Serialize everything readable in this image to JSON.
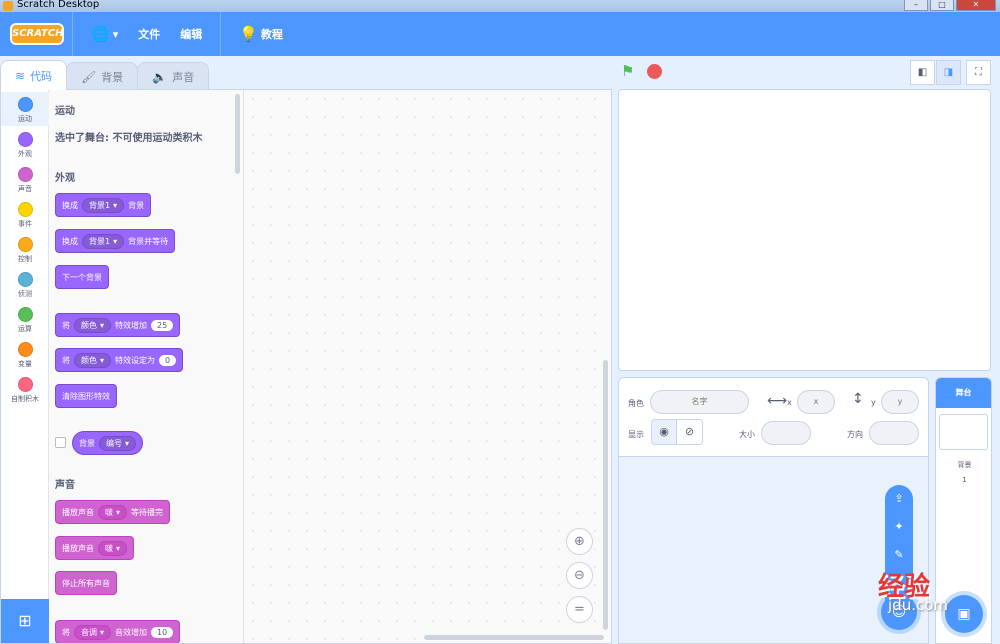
{
  "window": {
    "title": "Scratch Desktop",
    "controls": [
      "–",
      "□",
      "✕"
    ]
  },
  "menubar": {
    "logo": "SCRATCH",
    "language_icon": "globe-icon",
    "items": [
      {
        "label": "文件"
      },
      {
        "label": "编辑"
      }
    ],
    "tutorials_label": "教程"
  },
  "tabs": [
    {
      "label": "代码",
      "icon": "code-icon"
    },
    {
      "label": "背景",
      "icon": "brush-icon"
    },
    {
      "label": "声音",
      "icon": "speaker-icon"
    }
  ],
  "categories": [
    {
      "label": "运动",
      "color": "#4c97ff"
    },
    {
      "label": "外观",
      "color": "#9966ff"
    },
    {
      "label": "声音",
      "color": "#cf63cf"
    },
    {
      "label": "事件",
      "color": "#ffd500"
    },
    {
      "label": "控制",
      "color": "#ffab19"
    },
    {
      "label": "侦测",
      "color": "#5cb1d6"
    },
    {
      "label": "运算",
      "color": "#59c059"
    },
    {
      "label": "变量",
      "color": "#ff8c1a"
    },
    {
      "label": "自制积木",
      "color": "#ff6680"
    }
  ],
  "flyout": {
    "motion_heading": "运动",
    "motion_note": "选中了舞台: 不可使用运动类积木",
    "looks_heading": "外观",
    "looks_blocks": {
      "switch_backdrop": {
        "pre": "换成",
        "menu": "背景1",
        "post": "背景"
      },
      "switch_backdrop_wait": {
        "pre": "换成",
        "menu": "背景1",
        "post": "背景并等待"
      },
      "next_backdrop": "下一个背景",
      "change_effect": {
        "pre": "将",
        "menu": "颜色",
        "post": "特效增加",
        "value": "25"
      },
      "set_effect": {
        "pre": "将",
        "menu": "颜色",
        "post": "特效设定为",
        "value": "0"
      },
      "clear_effects": "清除图形特效",
      "backdrop_reporter": {
        "pre": "背景",
        "menu": "编号"
      }
    },
    "sound_heading": "声音",
    "sound_blocks": {
      "play_until_done": {
        "pre": "播放声音",
        "menu": "啵",
        "post": "等待播完"
      },
      "start_sound": {
        "pre": "播放声音",
        "menu": "啵"
      },
      "stop_all": "停止所有声音",
      "change_effect": {
        "pre": "将",
        "menu": "音调",
        "post": "音效增加",
        "value": "10"
      }
    }
  },
  "sprite_info": {
    "sprite_label": "角色",
    "name_placeholder": "名字",
    "x_label": "x",
    "x_placeholder": "x",
    "y_label": "y",
    "y_placeholder": "y",
    "show_label": "显示",
    "size_label": "大小",
    "direction_label": "方向"
  },
  "stage_target": {
    "header": "舞台",
    "backdrops_label": "背景",
    "backdrops_count": "1"
  },
  "watermark": {
    "brand": "经验",
    "domain": "jingyan.baidu.com"
  }
}
